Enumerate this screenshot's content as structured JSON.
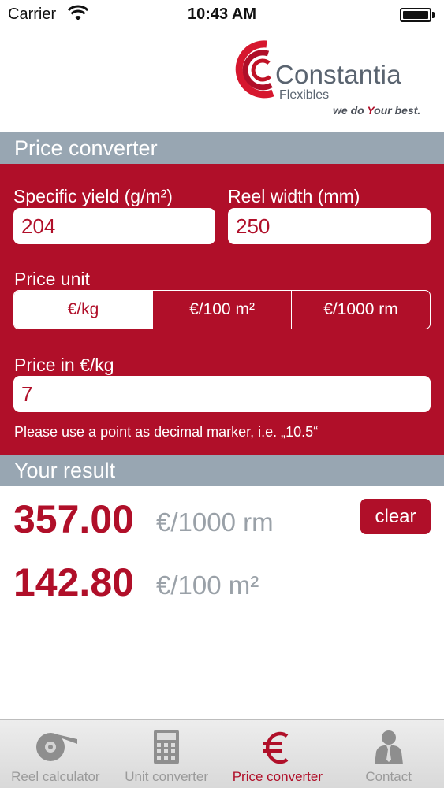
{
  "status_bar": {
    "carrier": "Carrier",
    "time": "10:43 AM"
  },
  "logo": {
    "name": "Constantia",
    "sub": "Flexibles",
    "slogan_pre": "we do ",
    "slogan_highlight": "Y",
    "slogan_post": "our best."
  },
  "price_converter": {
    "header": "Price converter",
    "specific_yield_label": "Specific yield (g/m²)",
    "specific_yield_value": "204",
    "reel_width_label": "Reel width (mm)",
    "reel_width_value": "250",
    "price_unit_label": "Price unit",
    "price_units": [
      "€/kg",
      "€/100 m²",
      "€/1000 rm"
    ],
    "selected_unit": "€/kg",
    "price_label": "Price in €/kg",
    "price_value": "7",
    "hint": "Please use a point as decimal marker, i.e. „10.5“"
  },
  "result": {
    "header": "Your result",
    "rows": [
      {
        "value": "357.00",
        "unit": "€/1000 rm"
      },
      {
        "value": "142.80",
        "unit": "€/100 m²"
      }
    ],
    "clear_label": "clear"
  },
  "tab_bar": {
    "tabs": [
      {
        "label": "Reel calculator",
        "icon": "reel-icon"
      },
      {
        "label": "Unit converter",
        "icon": "calculator-icon"
      },
      {
        "label": "Price converter",
        "icon": "euro-icon"
      },
      {
        "label": "Contact",
        "icon": "person-icon"
      }
    ],
    "active": "Price converter"
  },
  "colors": {
    "brand_red": "#b00f29",
    "header_gray": "#98a6b2",
    "unit_gray": "#9aa1a8"
  }
}
